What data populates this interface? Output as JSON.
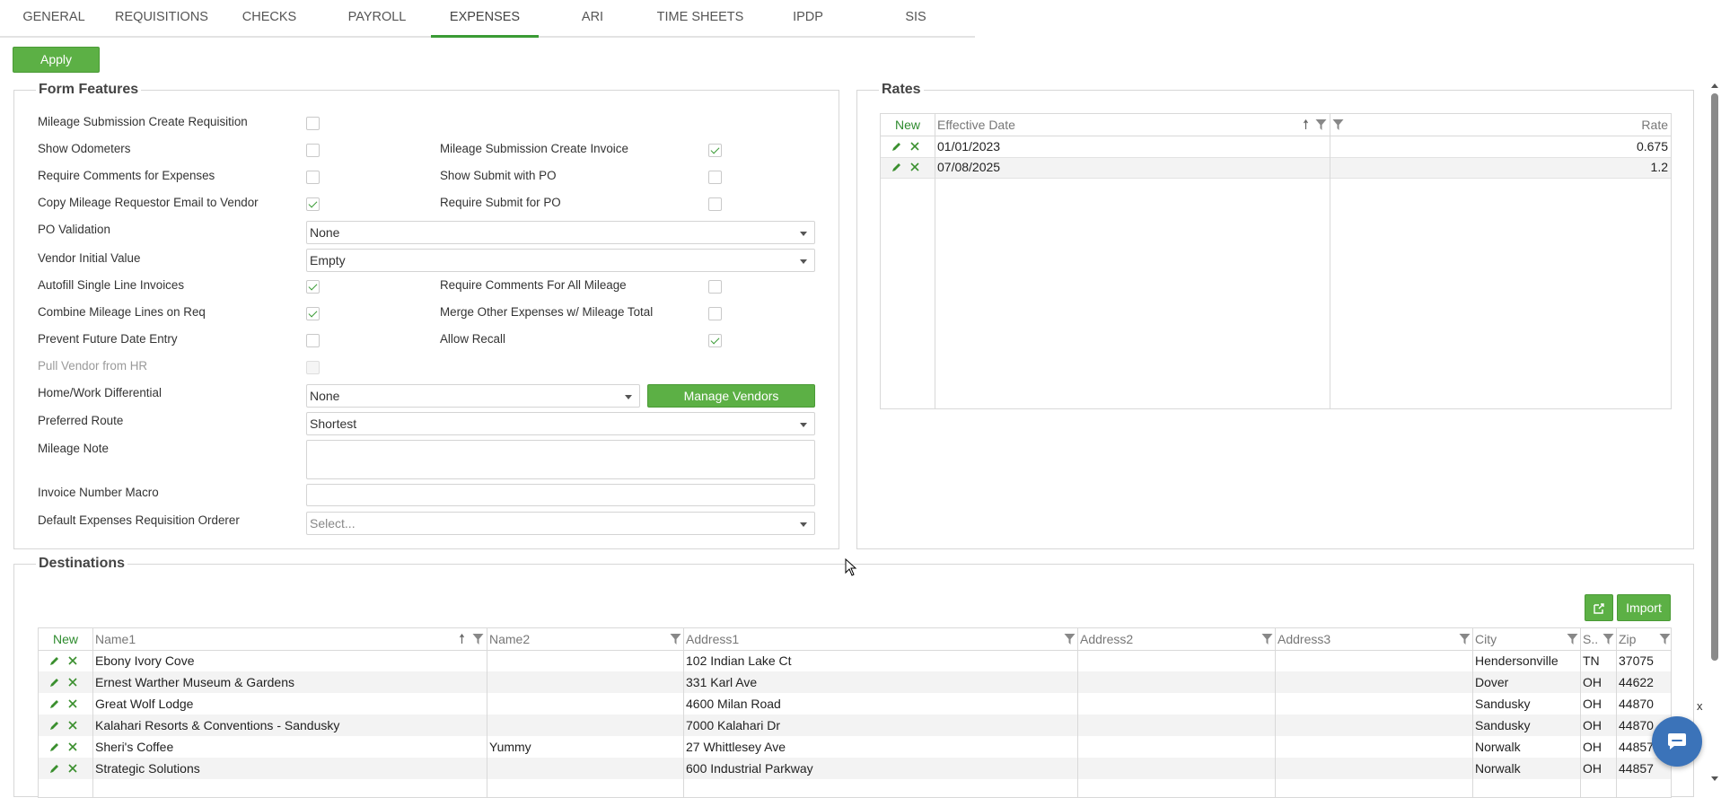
{
  "tabs": [
    "GENERAL",
    "REQUISITIONS",
    "CHECKS",
    "PAYROLL",
    "EXPENSES",
    "ARI",
    "TIME SHEETS",
    "IPDP",
    "SIS"
  ],
  "active_tab": "EXPENSES",
  "apply_label": "Apply",
  "form": {
    "legend": "Form Features",
    "mileage_sub_req": "Mileage Submission Create Requisition",
    "show_odometers": "Show Odometers",
    "mileage_sub_invoice": "Mileage Submission Create Invoice",
    "require_comments_exp": "Require Comments for Expenses",
    "show_submit_po": "Show Submit with PO",
    "copy_email": "Copy Mileage Requestor Email to Vendor",
    "require_submit_po": "Require Submit for PO",
    "po_validation": "PO Validation",
    "po_validation_value": "None",
    "vendor_initial": "Vendor Initial Value",
    "vendor_initial_value": "Empty",
    "autofill": "Autofill Single Line Invoices",
    "require_comments_all": "Require Comments For All Mileage",
    "combine_lines": "Combine Mileage Lines on Req",
    "merge_other": "Merge Other Expenses w/ Mileage Total",
    "prevent_future": "Prevent Future Date Entry",
    "allow_recall": "Allow Recall",
    "pull_vendor": "Pull Vendor from HR",
    "home_work": "Home/Work Differential",
    "home_work_value": "None",
    "manage_vendors": "Manage Vendors",
    "preferred_route": "Preferred Route",
    "preferred_route_value": "Shortest",
    "mileage_note": "Mileage Note",
    "invoice_macro": "Invoice Number Macro",
    "default_orderer": "Default Expenses Requisition Orderer",
    "default_orderer_placeholder": "Select..."
  },
  "rates": {
    "legend": "Rates",
    "new_label": "New",
    "col_date": "Effective Date",
    "col_rate": "Rate",
    "rows": [
      {
        "date": "01/01/2023",
        "rate": "0.675"
      },
      {
        "date": "07/08/2025",
        "rate": "1.2"
      }
    ]
  },
  "destinations": {
    "legend": "Destinations",
    "import_label": "Import",
    "new_label": "New",
    "columns": [
      "Name1",
      "Name2",
      "Address1",
      "Address2",
      "Address3",
      "City",
      "S..",
      "Zip"
    ],
    "rows": [
      [
        "Ebony Ivory Cove",
        "",
        "102 Indian Lake Ct",
        "",
        "",
        "Hendersonville",
        "TN",
        "37075"
      ],
      [
        "Ernest Warther Museum & Gardens",
        "",
        "331 Karl Ave",
        "",
        "",
        "Dover",
        "OH",
        "44622"
      ],
      [
        "Great Wolf Lodge",
        "",
        "4600 Milan Road",
        "",
        "",
        "Sandusky",
        "OH",
        "44870"
      ],
      [
        "Kalahari Resorts & Conventions - Sandusky",
        "",
        "7000 Kalahari Dr",
        "",
        "",
        "Sandusky",
        "OH",
        "44870"
      ],
      [
        "Sheri's Coffee",
        "Yummy",
        "27 Whittlesey Ave",
        "",
        "",
        "Norwalk",
        "OH",
        "44857"
      ],
      [
        "Strategic Solutions",
        "",
        "600 Industrial Parkway",
        "",
        "",
        "Norwalk",
        "OH",
        "44857"
      ]
    ]
  },
  "chat_close": "x",
  "accent": "#5cb045"
}
